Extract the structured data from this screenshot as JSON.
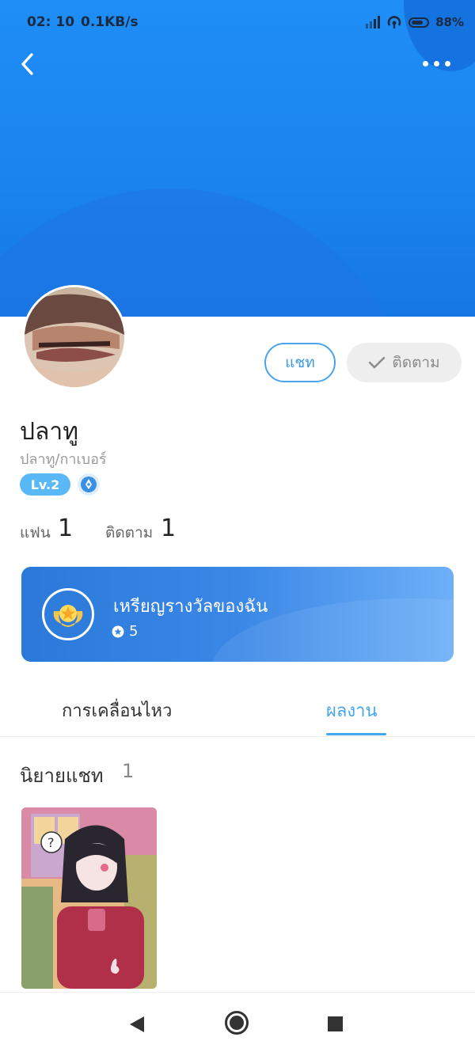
{
  "status_bar": {
    "time": "02: 10",
    "speed": "0.1KB/s",
    "battery": "88%"
  },
  "profile": {
    "name": "ปลาทู",
    "handle": "ปลาทู/กาเบอร์",
    "level": "Lv.2",
    "fans_label": "แฟน",
    "fans_count": "1",
    "following_label": "ติดตาม",
    "following_count": "1"
  },
  "actions": {
    "chat_label": "แชท",
    "follow_label": "ติดตาม"
  },
  "medals": {
    "title": "เหรียญรางวัลของฉัน",
    "count": "5"
  },
  "tabs": [
    {
      "label": "การเคลื่อนไหว",
      "active": false
    },
    {
      "label": "ผลงาน",
      "active": true
    }
  ],
  "works": {
    "section_title": "นิยายแชท",
    "count": "1"
  },
  "colors": {
    "header_blue": "#1f8ef6",
    "accent": "#45a6f0",
    "level_badge": "#59b8f6"
  },
  "icons": [
    "back-arrow-icon",
    "more-icon",
    "check-icon",
    "verified-pen-icon",
    "medal-icon",
    "star-icon",
    "fire-icon",
    "nav-back-icon",
    "nav-home-icon",
    "nav-recent-icon"
  ]
}
